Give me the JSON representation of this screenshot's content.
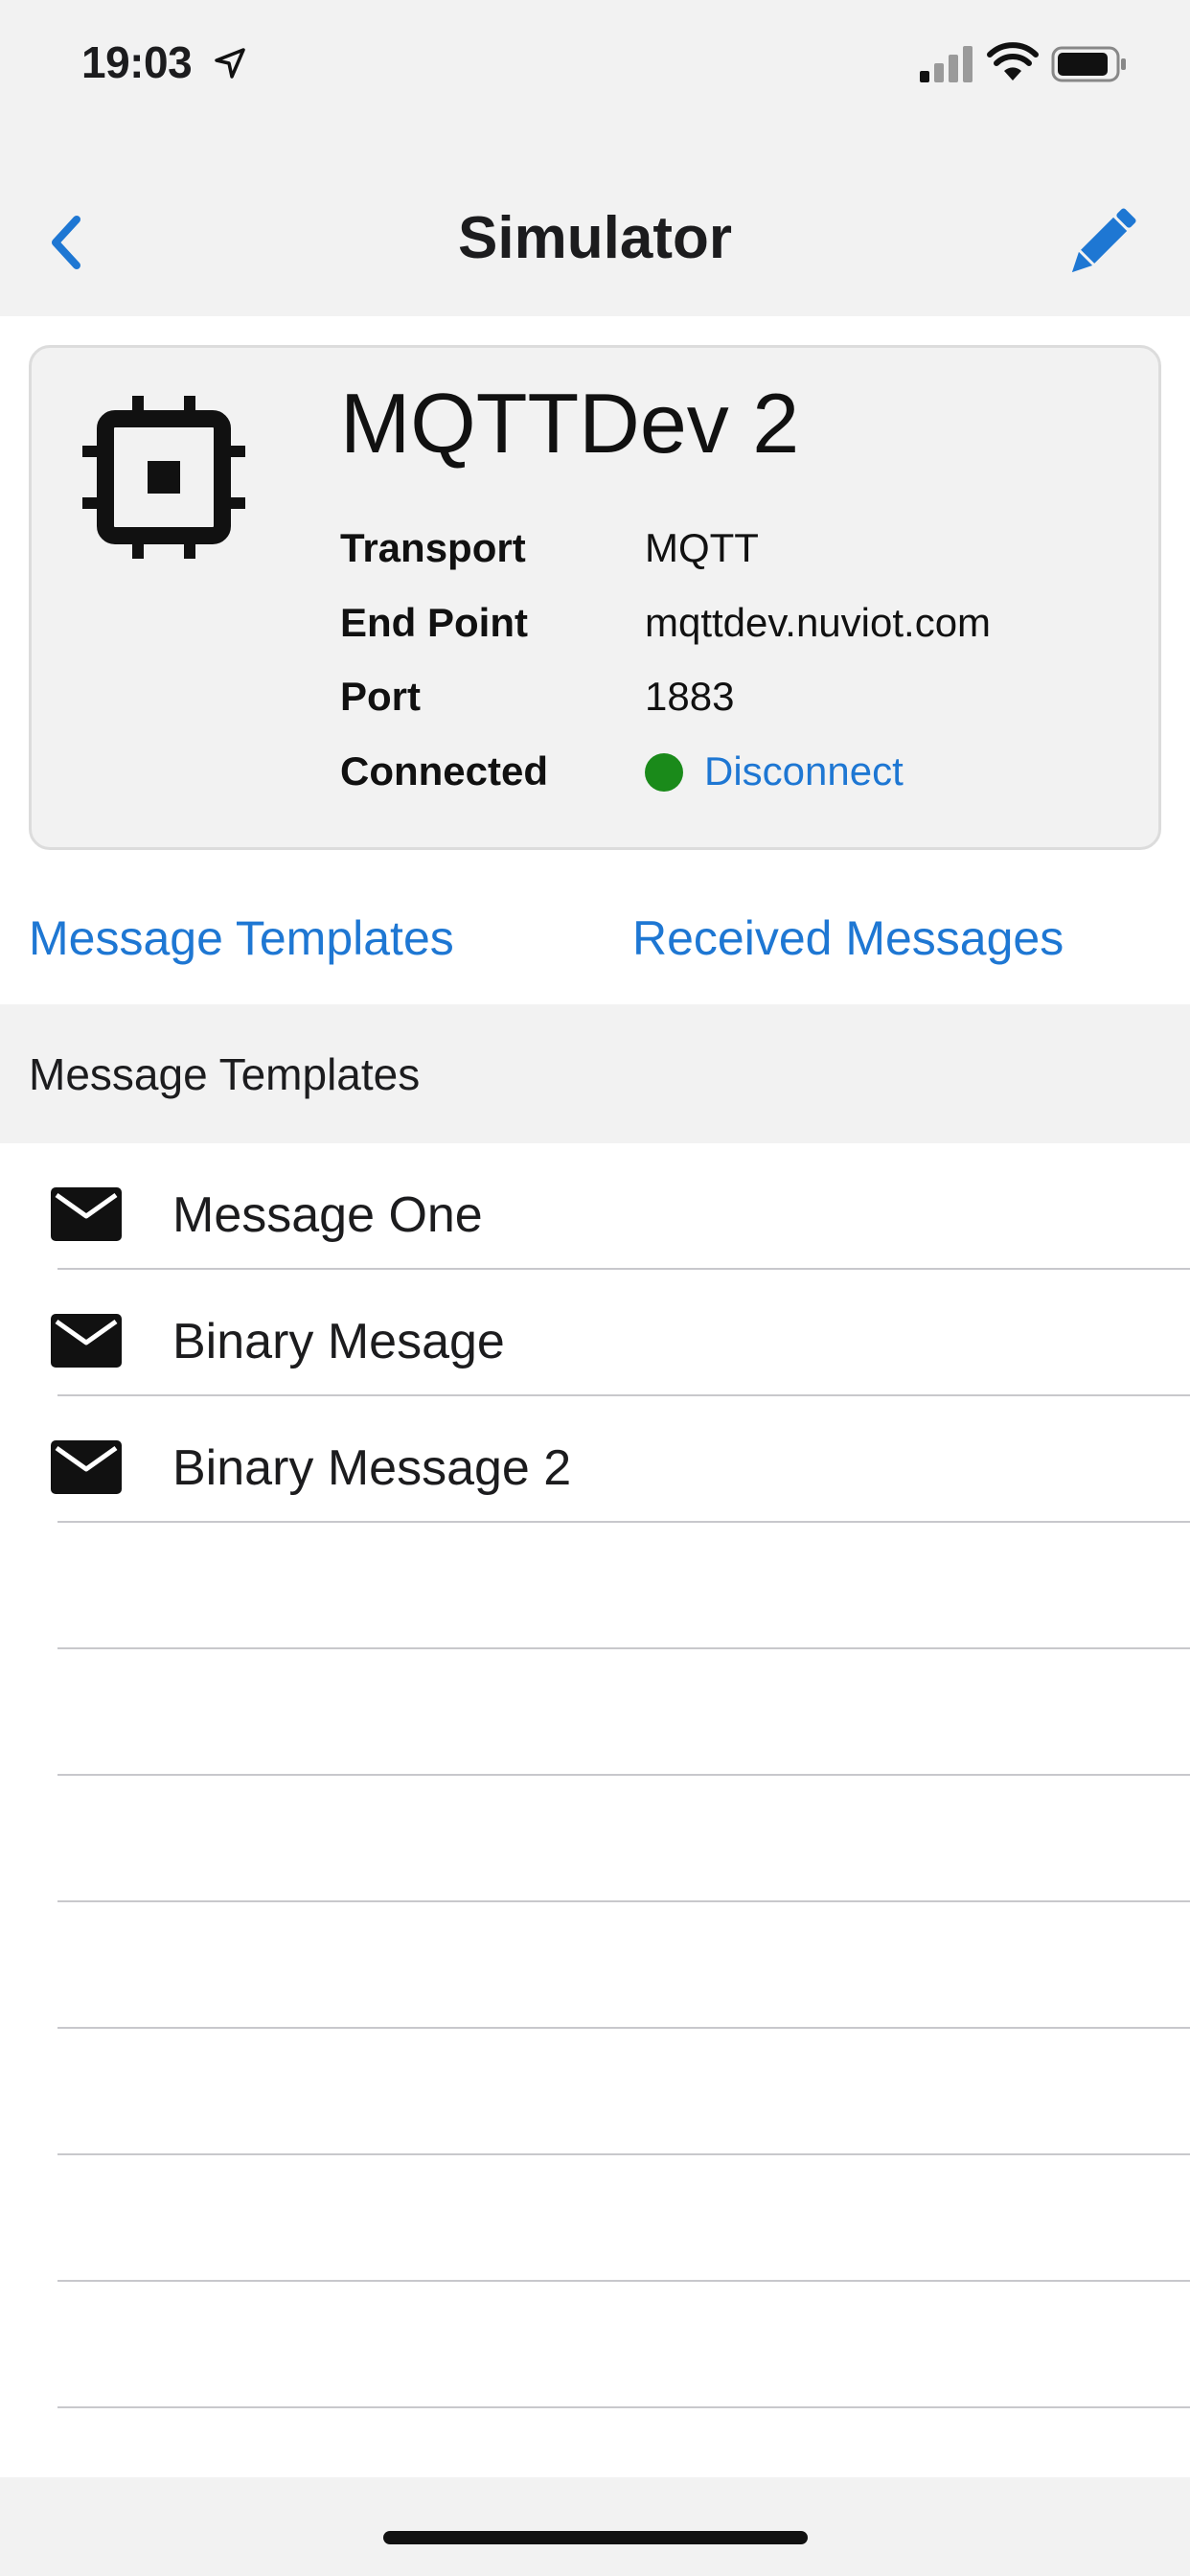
{
  "status_bar": {
    "time": "19:03"
  },
  "nav": {
    "title": "Simulator",
    "back_icon": "chevron-left-icon",
    "edit_icon": "pencil-icon"
  },
  "device": {
    "name": "MQTTDev 2",
    "icon": "chip-icon",
    "fields": {
      "transport_label": "Transport",
      "transport_value": "MQTT",
      "endpoint_label": "End Point",
      "endpoint_value": "mqttdev.nuviot.com",
      "port_label": "Port",
      "port_value": "1883",
      "connected_label": "Connected",
      "connected_status_color": "#1a8a1a",
      "disconnect_label": "Disconnect"
    }
  },
  "tabs": {
    "templates_label": "Message Templates",
    "received_label": "Received Messages"
  },
  "section": {
    "title": "Message Templates"
  },
  "templates": [
    {
      "label": "Message One",
      "icon": "envelope-icon"
    },
    {
      "label": "Binary Mesage",
      "icon": "envelope-icon"
    },
    {
      "label": "Binary Message 2",
      "icon": "envelope-icon"
    }
  ],
  "colors": {
    "accent": "#1e77d3",
    "background": "#f2f2f2",
    "card_border": "#dcdcdc"
  }
}
